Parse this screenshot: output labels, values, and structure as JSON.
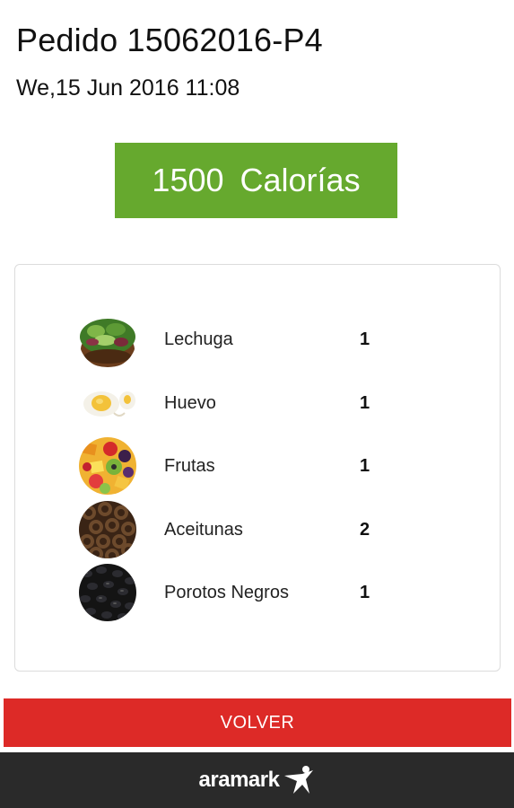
{
  "order": {
    "title": "Pedido 15062016-P4",
    "datetime": "We,15 Jun 2016 11:08"
  },
  "calories": {
    "value": "1500",
    "unit": "Calorías"
  },
  "items": [
    {
      "name": "Lechuga",
      "qty": "1",
      "icon": "lettuce-salad-icon"
    },
    {
      "name": "Huevo",
      "qty": "1",
      "icon": "egg-icon"
    },
    {
      "name": "Frutas",
      "qty": "1",
      "icon": "fruit-salad-icon"
    },
    {
      "name": "Aceitunas",
      "qty": "2",
      "icon": "olives-icon"
    },
    {
      "name": "Porotos Negros",
      "qty": "1",
      "icon": "black-beans-icon"
    }
  ],
  "actions": {
    "back_label": "VOLVER"
  },
  "footer": {
    "brand": "aramark",
    "logo_icon": "aramark-star-figure-icon"
  },
  "colors": {
    "calories_bg": "#66a92e",
    "back_button_bg": "#dd2a27",
    "footer_bg": "#2a2a2a"
  }
}
